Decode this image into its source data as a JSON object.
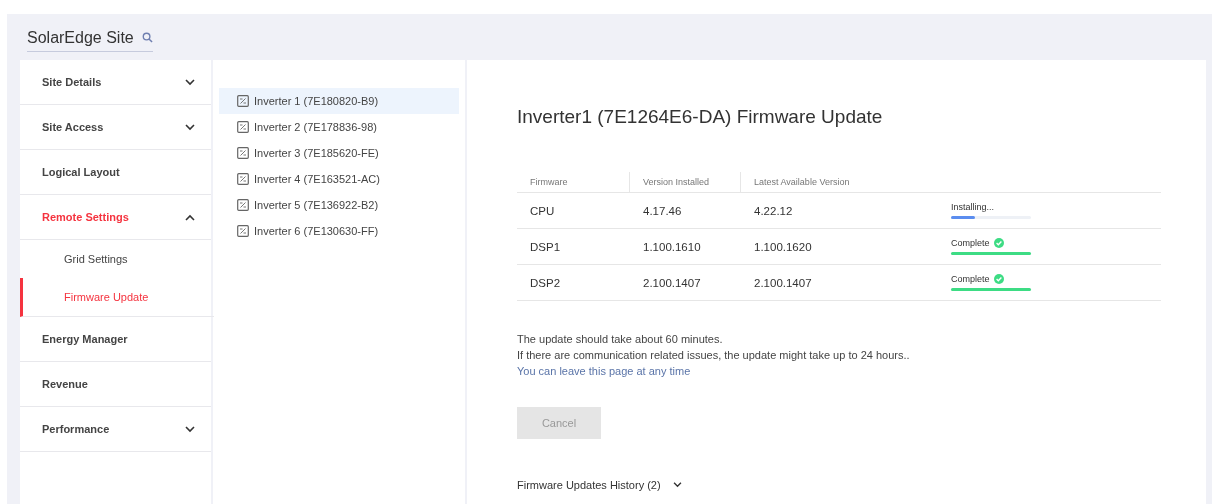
{
  "header": {
    "title": "SolarEdge Site"
  },
  "sidebar": {
    "items": [
      {
        "label": "Site Details",
        "kind": "group",
        "expanded": false,
        "selected": false
      },
      {
        "label": "Site Access",
        "kind": "group",
        "expanded": false,
        "selected": false
      },
      {
        "label": "Logical Layout",
        "kind": "link",
        "selected": false
      },
      {
        "label": "Remote Settings",
        "kind": "group",
        "expanded": true,
        "selected": true,
        "children": [
          {
            "label": "Grid Settings",
            "selected": false
          },
          {
            "label": "Firmware Update",
            "selected": true
          }
        ]
      },
      {
        "label": "Energy Manager",
        "kind": "link",
        "selected": false
      },
      {
        "label": "Revenue",
        "kind": "link",
        "selected": false
      },
      {
        "label": "Performance",
        "kind": "group",
        "expanded": false,
        "selected": false
      }
    ]
  },
  "inverters": [
    {
      "label": "Inverter 1 (7E180820-B9)",
      "selected": true
    },
    {
      "label": "Inverter 2 (7E178836-98)",
      "selected": false
    },
    {
      "label": "Inverter 3 (7E185620-FE)",
      "selected": false
    },
    {
      "label": "Inverter 4 (7E163521-AC)",
      "selected": false
    },
    {
      "label": "Inverter 5 (7E136922-B2)",
      "selected": false
    },
    {
      "label": "Inverter 6 (7E130630-FF)",
      "selected": false
    }
  ],
  "main": {
    "title": "Inverter1 (7E1264E6-DA) Firmware Update",
    "table": {
      "columns": [
        "Firmware",
        "Version Installed",
        "Latest Available Version"
      ],
      "rows": [
        {
          "firmware": "CPU",
          "installed": "4.17.46",
          "latest": "4.22.12",
          "status": "Installing...",
          "complete": false,
          "level": 0.3
        },
        {
          "firmware": "DSP1",
          "installed": "1.100.1610",
          "latest": "1.100.1620",
          "status": "Complete",
          "complete": true,
          "level": 1
        },
        {
          "firmware": "DSP2",
          "installed": "2.100.1407",
          "latest": "2.100.1407",
          "status": "Complete",
          "complete": true,
          "level": 1
        }
      ]
    },
    "notes": [
      "The update should take about 60 minutes.",
      "If there are communication related issues, the update might take up to 24 hours.."
    ],
    "link": "You can leave this page at any time",
    "cancel": {
      "label": "Cancel",
      "disabled": true
    },
    "history": {
      "label": "Firmware Updates History (2)",
      "expanded": false
    }
  }
}
